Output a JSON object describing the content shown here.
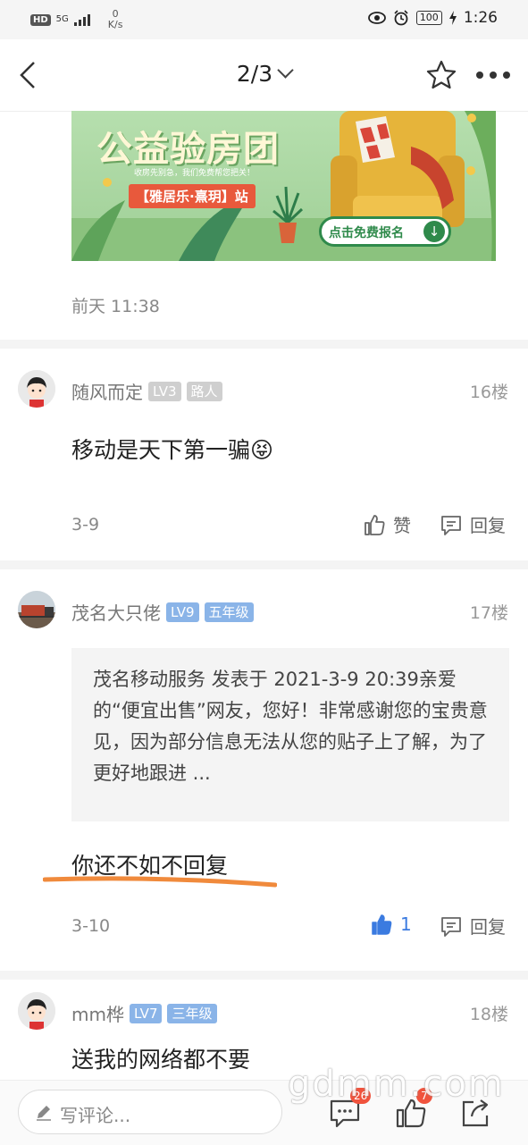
{
  "status_bar": {
    "hd": "HD",
    "network": "5G",
    "speed_value": "0",
    "speed_unit": "K/s",
    "battery": "100",
    "time": "1:26"
  },
  "nav": {
    "pager": "2/3"
  },
  "banner": {
    "title": "公益验房团",
    "subtitle": "收房先别急，我们免费帮您把关！",
    "tag": "【雅居乐·熹玥】站",
    "button": "点击免费报名"
  },
  "post_time": "前天 11:38",
  "comments": [
    {
      "user": "随风而定",
      "level": "LV3",
      "rank": "路人",
      "floor": "16楼",
      "text": "移动是天下第一骗",
      "emoji": "😝",
      "date": "3-9",
      "like_label": "赞",
      "reply_label": "回复"
    },
    {
      "user": "茂名大只佬",
      "level": "LV9",
      "rank": "五年级",
      "floor": "17楼",
      "quote": "茂名移动服务 发表于 2021-3-9 20:39亲爱的“便宜出售”网友，您好！非常感谢您的宝贵意见，因为部分信息无法从您的贴子上了解，为了更好地跟进 ...",
      "text": "你还不如不回复",
      "date": "3-10",
      "like_count": "1",
      "reply_label": "回复"
    },
    {
      "user": "mm桦",
      "level": "LV7",
      "rank": "三年级",
      "floor": "18楼",
      "text": "送我的网络都不要"
    }
  ],
  "bottom_bar": {
    "comment_placeholder": "写评论...",
    "comments_badge": "26",
    "likes_badge": "7"
  },
  "watermark": "gdmm.com",
  "colors": {
    "level_blue": "#8ab4e8",
    "level_gray": "#cfcfcf",
    "badge_red": "#f0533d",
    "like_active": "#3b7be0",
    "underline_orange": "#f08a3c"
  },
  "icons": [
    "back-arrow-icon",
    "chevron-down-icon",
    "star-icon",
    "more-icon",
    "thumbs-up-icon",
    "reply-icon",
    "pencil-icon",
    "comment-icon",
    "like-icon",
    "share-icon"
  ]
}
